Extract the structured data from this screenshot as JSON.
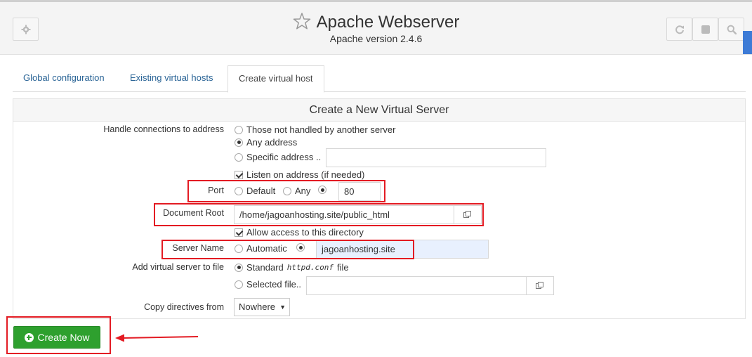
{
  "header": {
    "title": "Apache Webserver",
    "subtitle": "Apache version 2.4.6",
    "icons": [
      "gear-icon",
      "star-icon",
      "refresh-icon",
      "stop-icon",
      "search-icon"
    ]
  },
  "tabs": [
    {
      "label": "Global configuration",
      "active": false
    },
    {
      "label": "Existing virtual hosts",
      "active": false
    },
    {
      "label": "Create virtual host",
      "active": true
    }
  ],
  "form": {
    "heading": "Create a New Virtual Server",
    "handle": {
      "label": "Handle connections to address",
      "opt1": "Those not handled by another server",
      "opt2": "Any address",
      "opt3": "Specific address ..",
      "specific_value": "",
      "listen_label": "Listen on address (if needed)"
    },
    "port": {
      "label": "Port",
      "opt_default": "Default",
      "opt_any": "Any",
      "value": "80"
    },
    "docroot": {
      "label": "Document Root",
      "value": "/home/jagoanhosting.site/public_html",
      "allow_label": "Allow access to this directory"
    },
    "servername": {
      "label": "Server Name",
      "opt_auto": "Automatic",
      "value": "jagoanhosting.site"
    },
    "addfile": {
      "label": "Add virtual server to file",
      "opt_standard": "Standard",
      "standard_file": "httpd.conf",
      "standard_suffix": "file",
      "opt_selected": "Selected file..",
      "selected_value": ""
    },
    "copy": {
      "label": "Copy directives from",
      "value": "Nowhere"
    }
  },
  "create_button": "Create Now",
  "colors": {
    "accent_blue": "#2a6496",
    "highlight_red": "#e31b23",
    "button_green": "#2ea02e"
  }
}
